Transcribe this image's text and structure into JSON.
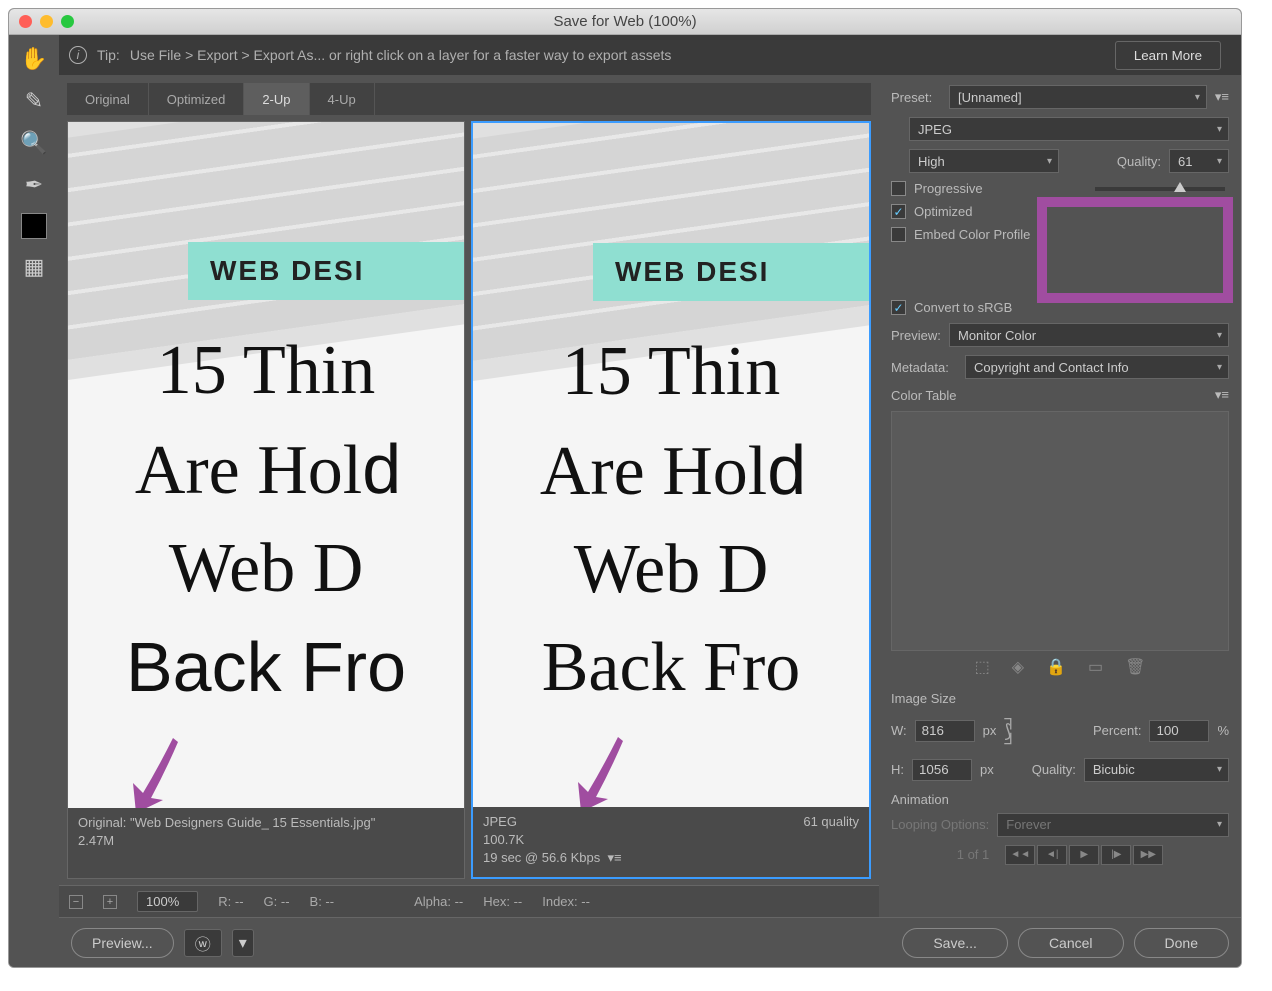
{
  "window": {
    "title": "Save for Web (100%)"
  },
  "tip": {
    "prefix": "Tip:",
    "text": "Use File > Export > Export As...  or right click on a layer for a faster way to export assets",
    "learn": "Learn More"
  },
  "tabs": [
    "Original",
    "Optimized",
    "2-Up",
    "4-Up"
  ],
  "active_tab": "2-Up",
  "preview_image": {
    "banner": "WEB DESI",
    "headline": "15 Thin\nAre Hold\nWeb D\nBack Fro"
  },
  "original": {
    "line1": "Original: \"Web Designers Guide_ 15 Essentials.jpg\"",
    "line2": "2.47M"
  },
  "optimized": {
    "fmt": "JPEG",
    "size": "100.7K",
    "time": "19 sec @ 56.6 Kbps",
    "qual": "61 quality"
  },
  "status": {
    "zoom": "100%",
    "r": "R: --",
    "g": "G: --",
    "b": "B: --",
    "alpha": "Alpha: --",
    "hex": "Hex: --",
    "index": "Index: --"
  },
  "footer": {
    "preview": "Preview...",
    "save": "Save...",
    "cancel": "Cancel",
    "done": "Done"
  },
  "side": {
    "preset_lbl": "Preset:",
    "preset_val": "[Unnamed]",
    "format": "JPEG",
    "comp": "High",
    "quality_lbl": "Quality:",
    "quality_val": "61",
    "progressive": "Progressive",
    "optimized": "Optimized",
    "embed": "Embed Color Profile",
    "convert": "Convert to sRGB",
    "prev_lbl": "Preview:",
    "prev_val": "Monitor Color",
    "meta_lbl": "Metadata:",
    "meta_val": "Copyright and Contact Info",
    "ct_lbl": "Color Table",
    "size_hdr": "Image Size",
    "w_lbl": "W:",
    "w_val": "816",
    "h_lbl": "H:",
    "h_val": "1056",
    "px": "px",
    "pct_lbl": "Percent:",
    "pct_val": "100",
    "pct_unit": "%",
    "q_lbl": "Quality:",
    "q_val": "Bicubic",
    "anim_hdr": "Animation",
    "loop_lbl": "Looping Options:",
    "loop_val": "Forever",
    "frame": "1 of 1"
  }
}
